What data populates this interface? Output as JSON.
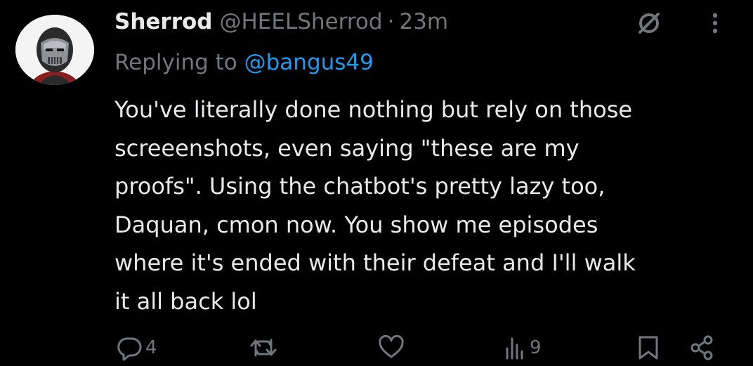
{
  "tweet": {
    "display_name": "Sherrod",
    "handle": "@HEELSherrod",
    "separator": "·",
    "time": "23m",
    "replying_prefix": "Replying to ",
    "replying_to": "@bangus49",
    "body_lines": [
      "You've literally done nothing but rely on those",
      "screeenshots, even saying \"these are my",
      "proofs\". Using the chatbot's pretty lazy too,",
      "Daquan, cmon now. You show me episodes",
      "where it's ended with their defeat and I'll walk",
      "it all back lol"
    ]
  },
  "actions": {
    "reply_count": "4",
    "retweet_count": "",
    "like_count": "",
    "view_count": "9"
  },
  "icons": {
    "avatar": "masked-avatar",
    "grok": "grok-icon",
    "more": "more-vertical-icon",
    "reply": "reply-icon",
    "retweet": "retweet-icon",
    "like": "heart-icon",
    "views": "views-icon",
    "bookmark": "bookmark-icon",
    "share": "share-icon"
  },
  "colors": {
    "background": "#000000",
    "text_primary": "#e7e9ea",
    "text_secondary": "#71767b",
    "link": "#1d9bf0"
  }
}
